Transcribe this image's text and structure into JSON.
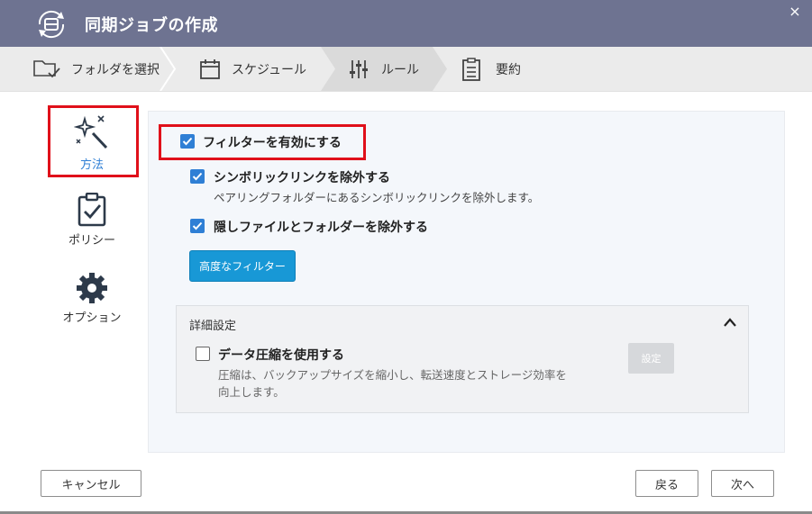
{
  "window": {
    "title": "同期ジョブの作成",
    "close_glyph": "×"
  },
  "steps": [
    {
      "label": "フォルダを選択",
      "icon": "folder-check-icon"
    },
    {
      "label": "スケジュール",
      "icon": "calendar-icon"
    },
    {
      "label": "ルール",
      "icon": "sliders-icon",
      "active": true
    },
    {
      "label": "要約",
      "icon": "clipboard-list-icon"
    }
  ],
  "sidebar": {
    "items": [
      {
        "label": "方法",
        "icon": "magic-wand-icon",
        "selected": true
      },
      {
        "label": "ポリシー",
        "icon": "clipboard-check-icon"
      },
      {
        "label": "オプション",
        "icon": "gear-icon"
      }
    ]
  },
  "filters": {
    "enable_label": "フィルターを有効にする",
    "enable_checked": true,
    "symlink_label": "シンボリックリンクを除外する",
    "symlink_checked": true,
    "symlink_desc": "ペアリングフォルダーにあるシンボリックリンクを除外します。",
    "hidden_label": "隠しファイルとフォルダーを除外する",
    "hidden_checked": true,
    "advanced_button": "高度なフィルター"
  },
  "advanced": {
    "title": "詳細設定",
    "compress_label": "データ圧縮を使用する",
    "compress_checked": false,
    "compress_desc_1": "圧縮は、バックアップサイズを縮小し、転送速度とストレージ効率を",
    "compress_desc_2": "向上します。",
    "settings_button": "設定"
  },
  "footer": {
    "cancel": "キャンセル",
    "back": "戻る",
    "next": "次へ"
  },
  "colors": {
    "titlebar": "#6e7391",
    "accent_blue": "#1898d6",
    "checkbox_blue": "#2f7fd5",
    "highlight_red": "#e0101a"
  }
}
